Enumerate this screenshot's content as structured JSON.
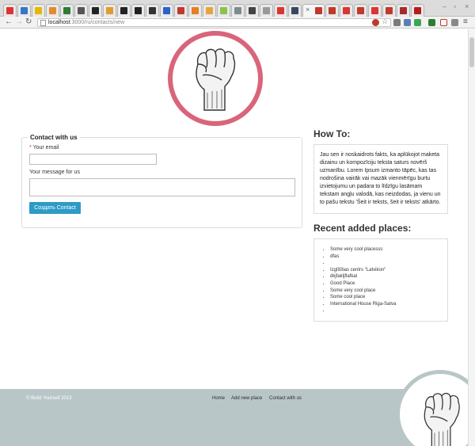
{
  "browser": {
    "url_host": "localhost",
    "url_path": ":3000/ru/contacts/new",
    "back_icon": "arrow-left-icon",
    "forward_icon": "arrow-right-icon",
    "reload_icon": "reload-icon",
    "menu_icon": "hamburger-icon",
    "close_tab_glyph": "×",
    "window_controls": {
      "minimize": "–",
      "maximize": "▫",
      "close": "×"
    },
    "tab_colors": [
      "#d33",
      "#3576c9",
      "#e6b800",
      "#e58b2a",
      "#2e7d32",
      "#555",
      "#222",
      "#e39b2d",
      "#222",
      "#222",
      "#333",
      "#2b62c8",
      "#c0392b",
      "#e67e22",
      "#e8a33d",
      "#8bc34a",
      "#7f8c8d",
      "#444",
      "#999",
      "#d33",
      "#34495e",
      "#c0392b",
      "#c0392b",
      "#d33",
      "#c0392b",
      "#d33",
      "#c0392b",
      "#a52a2a",
      "#b71c1c"
    ]
  },
  "contact_form": {
    "legend": "Contact with us",
    "email_required_mark": "*",
    "email_label": "Your email",
    "message_label": "Your message for us",
    "submit_label": "Создать Contact"
  },
  "howto": {
    "heading": "How To:",
    "text": "Jau sen ir noskaidrots fakts, ka aplūkojot maketa dizainu un kompozīciju teksta saturs novērš uzmanību. Lorem Ipsum izmanto tāpēc, kas tas nodrošina vairāk vai mazāk vienmērīgu burtu izvietojumu un padara to līdzīgu lasāmam tekstam angļu valodā, kas neizdodas, ja vienu un to pašu tekstu 'Šeit ir teksts, šeit ir teksts' atkārto."
  },
  "recent_places": {
    "heading": "Recent added places:",
    "items": [
      "Some very cool placesss",
      "dfas",
      "",
      "Izglītības centrs \"Latvikon\"",
      "dkjfakljflafkal",
      "Good Place",
      "Some very cool place",
      "Some cool place",
      "International House Riga-Satva",
      ""
    ]
  },
  "footer": {
    "copyright": "© Build Yourself 2013",
    "nav": [
      "Home",
      "Add new place",
      "Contact with us"
    ]
  },
  "colors": {
    "logo_ring": "#d9657b",
    "footer_bg": "#b9c6c8",
    "button": "#2d9bc5"
  }
}
